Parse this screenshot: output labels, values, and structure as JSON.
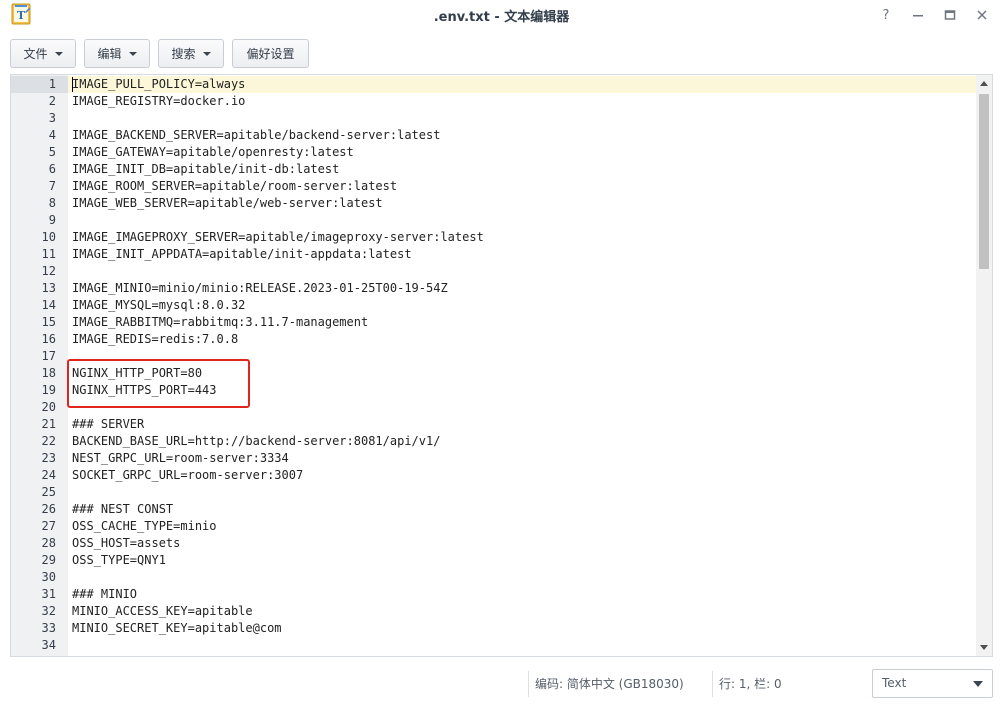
{
  "window": {
    "title": ".env.txt - 文本编辑器",
    "app_icon": "text-editor-icon",
    "controls": {
      "help": "?",
      "minimize": "–",
      "maximize": "□",
      "close": "✕"
    }
  },
  "toolbar": {
    "file_label": "文件",
    "edit_label": "编辑",
    "search_label": "搜索",
    "prefs_label": "偏好设置"
  },
  "editor": {
    "active_line": 1,
    "highlight_color": "#e0251f",
    "lines": [
      {
        "n": "1",
        "text": "IMAGE_PULL_POLICY=always"
      },
      {
        "n": "2",
        "text": "IMAGE_REGISTRY=docker.io"
      },
      {
        "n": "3",
        "text": ""
      },
      {
        "n": "4",
        "text": "IMAGE_BACKEND_SERVER=apitable/backend-server:latest"
      },
      {
        "n": "5",
        "text": "IMAGE_GATEWAY=apitable/openresty:latest"
      },
      {
        "n": "6",
        "text": "IMAGE_INIT_DB=apitable/init-db:latest"
      },
      {
        "n": "7",
        "text": "IMAGE_ROOM_SERVER=apitable/room-server:latest"
      },
      {
        "n": "8",
        "text": "IMAGE_WEB_SERVER=apitable/web-server:latest"
      },
      {
        "n": "9",
        "text": ""
      },
      {
        "n": "10",
        "text": "IMAGE_IMAGEPROXY_SERVER=apitable/imageproxy-server:latest"
      },
      {
        "n": "11",
        "text": "IMAGE_INIT_APPDATA=apitable/init-appdata:latest"
      },
      {
        "n": "12",
        "text": ""
      },
      {
        "n": "13",
        "text": "IMAGE_MINIO=minio/minio:RELEASE.2023-01-25T00-19-54Z"
      },
      {
        "n": "14",
        "text": "IMAGE_MYSQL=mysql:8.0.32"
      },
      {
        "n": "15",
        "text": "IMAGE_RABBITMQ=rabbitmq:3.11.7-management"
      },
      {
        "n": "16",
        "text": "IMAGE_REDIS=redis:7.0.8"
      },
      {
        "n": "17",
        "text": ""
      },
      {
        "n": "18",
        "text": "NGINX_HTTP_PORT=80"
      },
      {
        "n": "19",
        "text": "NGINX_HTTPS_PORT=443"
      },
      {
        "n": "20",
        "text": ""
      },
      {
        "n": "21",
        "text": "### SERVER"
      },
      {
        "n": "22",
        "text": "BACKEND_BASE_URL=http://backend-server:8081/api/v1/"
      },
      {
        "n": "23",
        "text": "NEST_GRPC_URL=room-server:3334"
      },
      {
        "n": "24",
        "text": "SOCKET_GRPC_URL=room-server:3007"
      },
      {
        "n": "25",
        "text": ""
      },
      {
        "n": "26",
        "text": "### NEST CONST"
      },
      {
        "n": "27",
        "text": "OSS_CACHE_TYPE=minio"
      },
      {
        "n": "28",
        "text": "OSS_HOST=assets"
      },
      {
        "n": "29",
        "text": "OSS_TYPE=QNY1"
      },
      {
        "n": "30",
        "text": ""
      },
      {
        "n": "31",
        "text": "### MINIO"
      },
      {
        "n": "32",
        "text": "MINIO_ACCESS_KEY=apitable"
      },
      {
        "n": "33",
        "text": "MINIO_SECRET_KEY=apitable@com"
      },
      {
        "n": "34",
        "text": ""
      }
    ]
  },
  "statusbar": {
    "encoding": "编码: 简体中文 (GB18030)",
    "position": "行: 1, 栏: 0",
    "language": "Text"
  }
}
